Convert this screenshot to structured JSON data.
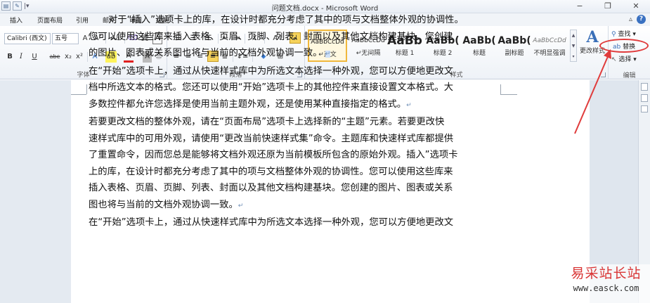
{
  "window": {
    "title": "问题文档.docx - Microsoft Word",
    "minimize": "−",
    "restore": "❐",
    "close": "✕"
  },
  "quick_access": {
    "save_icon": "save-icon",
    "doc_icon": "doc-icon",
    "menu_glyph": "|▾"
  },
  "tabs": [
    "插入",
    "页面布局",
    "引用",
    "邮件",
    "审阅",
    "视图"
  ],
  "help": {
    "minimize_ribbon": "▵",
    "help": "?"
  },
  "font_group": {
    "font_name": "Calibri (西文)",
    "font_size": "五号",
    "grow": "A˄",
    "shrink": "A˅",
    "case": "Aa",
    "clear": "⌫",
    "phonetic": "變",
    "border": "A",
    "bold": "B",
    "italic": "I",
    "underline": "U",
    "strike": "abe",
    "sub": "x₂",
    "sup": "x²",
    "effects": "A",
    "highlight": "ab",
    "font_color": "A",
    "shading": "A",
    "enclose": "㊂",
    "label": "字体"
  },
  "paragraph_group": {
    "bullets": "☰",
    "numbering": "☰",
    "multilevel": "☰",
    "decrease_indent": "⇤",
    "increase_indent": "⇥",
    "sort_text": "A↓",
    "chinese_layout": "X",
    "show_marks": "↲",
    "align_left": "≡",
    "align_center": "≡",
    "align_right": "≡",
    "justify": "≡",
    "distribute": "≣",
    "line_spacing": "↕≡",
    "shading": "⬥",
    "borders": "⊞",
    "label": "段落"
  },
  "styles_group": {
    "styles": [
      {
        "preview": "AaBbCcDd",
        "name": "↵正文"
      },
      {
        "preview": "AaBbCcDd",
        "name": "↵无间隔"
      },
      {
        "preview": "AaBb",
        "name": "标题 1"
      },
      {
        "preview": "AaBb(",
        "name": "标题 2"
      },
      {
        "preview": "AaBb(",
        "name": "标题"
      },
      {
        "preview": "AaBb(",
        "name": "副标题"
      },
      {
        "preview": "AaBbCcDd",
        "name": "不明显强调"
      }
    ],
    "change_styles": "更改样式",
    "label": "样式"
  },
  "editing_group": {
    "find": "查找",
    "replace": "替换",
    "select": "选择",
    "label": "编辑"
  },
  "document": {
    "lines": [
      "对于“插入”选项卡上的库，在设计时都充分考虑了其中的项与文档整体外观的协调性。",
      "您可以使用这些库来插入表格、页眉、页脚、列表、封面以及其他文档构建基块。您创建",
      "的图片、图表或关系图也将与当前的文档外观协调一致。",
      "在“开始”选项卡上，通过从快速样式库中为所选文本选择一种外观，您可以方便地更改文",
      "档中所选文本的格式。您还可以使用“开始”选项卡上的其他控件来直接设置文本格式。大",
      "多数控件都允许您选择是使用当前主题外观，还是使用某种直接指定的格式。",
      "若要更改文档的整体外观，请在“页面布局”选项卡上选择新的“主题”元素。若要更改快",
      "速样式库中的可用外观，请使用“更改当前快速样式集”命令。主题库和快速样式库都提供",
      "了重置命令，因而您总是能够将文档外观还原为当前模板所包含的原始外观。插入”选项卡",
      "上的库，在设计时都充分考虑了其中的项与文档整体外观的协调性。您可以使用这些库来",
      "插入表格、页眉、页脚、列表、封面以及其他文档构建基块。您创建的图片、图表或关系",
      "图也将与当前的文档外观协调一致。",
      "在“开始”选项卡上，通过从快速样式库中为所选文本选择一种外观，您可以方便地更改文"
    ],
    "para_mark": "↵"
  },
  "watermark": {
    "line1": "易采站长站",
    "line2": "www.easck.com"
  },
  "colors": {
    "accent": "#3a71c1",
    "callout": "#e03b3b",
    "style_selected": "#f0b83c"
  }
}
